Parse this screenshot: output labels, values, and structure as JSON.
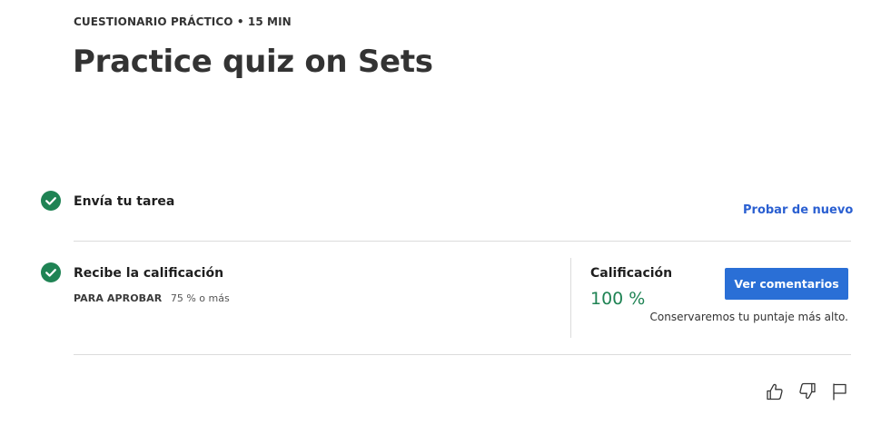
{
  "header": {
    "eyebrow": "CUESTIONARIO PRÁCTICO • 15 MIN",
    "title": "Practice quiz on Sets"
  },
  "steps": {
    "submit": {
      "title": "Envía tu tarea",
      "retry_link": "Probar de nuevo",
      "status_icon": "check-circle-icon"
    },
    "grade": {
      "title": "Recibe la calificación",
      "pass_label": "PARA APROBAR",
      "pass_value": "75 % o más",
      "status_icon": "check-circle-icon",
      "grade_label": "Calificación",
      "grade_value": "100 %",
      "feedback_button": "Ver comentarios",
      "keep_note": "Conservaremos tu puntaje más alto."
    }
  },
  "footer_icons": [
    "thumbs-up-icon",
    "thumbs-down-icon",
    "flag-icon"
  ],
  "colors": {
    "success": "#1f8354",
    "link": "#2a5fd1",
    "primary_button": "#2a6fd6"
  }
}
